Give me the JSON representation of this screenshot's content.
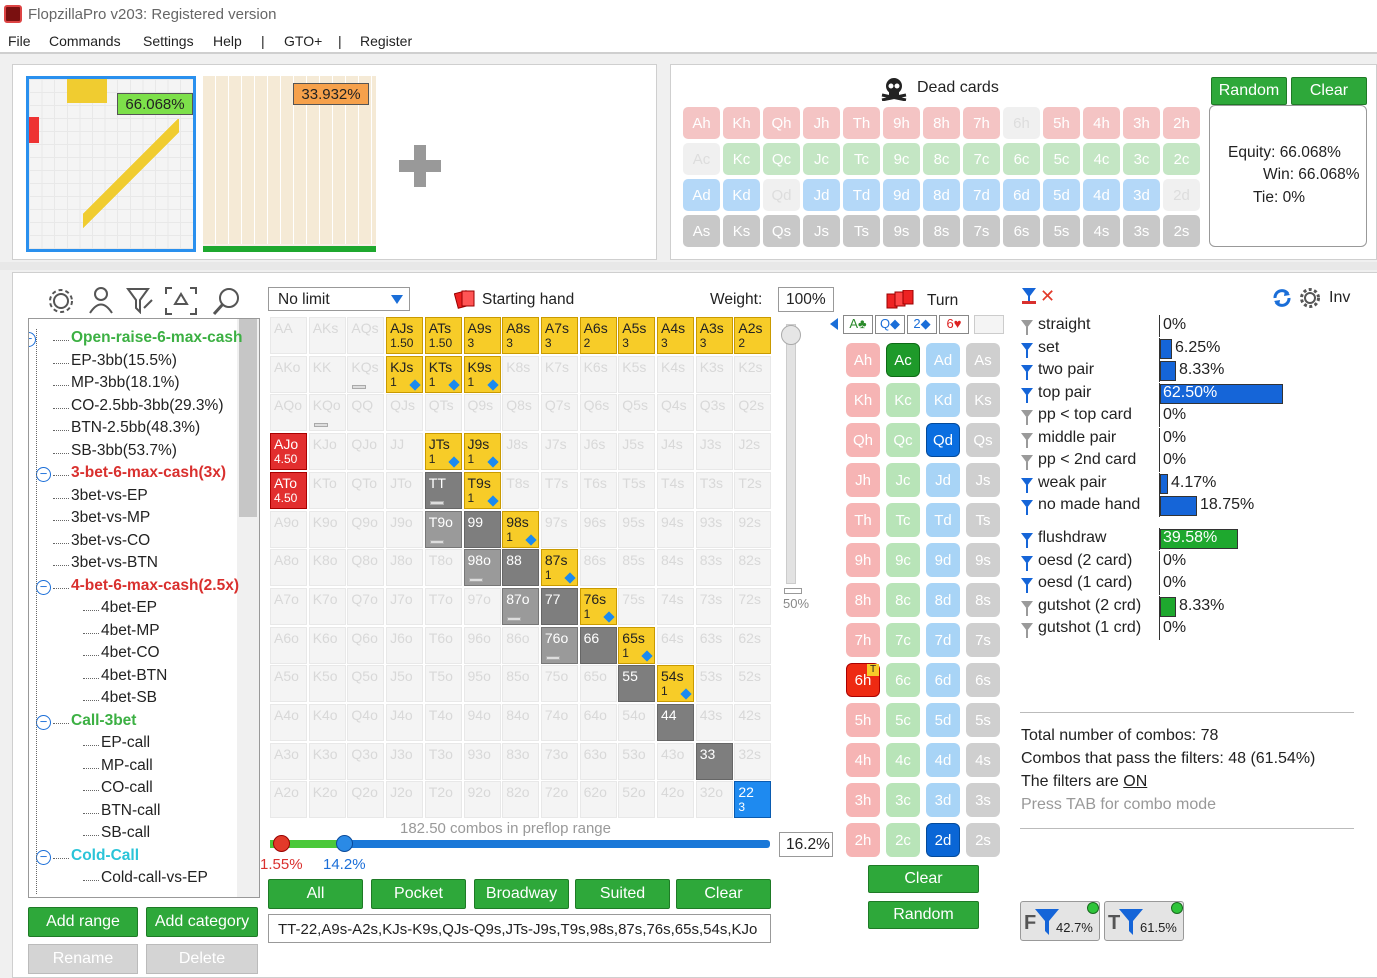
{
  "window": {
    "title": "FlopzillaPro v203: Registered version"
  },
  "menu": [
    "File",
    "Commands",
    "Settings",
    "Help",
    "|",
    "GTO+",
    "|",
    "Register"
  ],
  "thumbnails": [
    {
      "equity": "66.068%",
      "color": "#7de04a"
    },
    {
      "equity": "33.932%",
      "color": "#f6a14b"
    }
  ],
  "dead_cards": {
    "title": "Dead cards",
    "random_label": "Random",
    "clear_label": "Clear",
    "rows": [
      [
        "Ah",
        "Kh",
        "Qh",
        "Jh",
        "Th",
        "9h",
        "8h",
        "7h",
        "6h",
        "5h",
        "4h",
        "3h",
        "2h"
      ],
      [
        "Ac",
        "Kc",
        "Qc",
        "Jc",
        "Tc",
        "9c",
        "8c",
        "7c",
        "6c",
        "5c",
        "4c",
        "3c",
        "2c"
      ],
      [
        "Ad",
        "Kd",
        "Qd",
        "Jd",
        "Td",
        "9d",
        "8d",
        "7d",
        "6d",
        "5d",
        "4d",
        "3d",
        "2d"
      ],
      [
        "As",
        "Ks",
        "Qs",
        "Js",
        "Ts",
        "9s",
        "8s",
        "7s",
        "6s",
        "5s",
        "4s",
        "3s",
        "2s"
      ]
    ]
  },
  "equity": {
    "equity": "Equity: 66.068%",
    "win": "Win: 66.068%",
    "tie": "Tie: 0%"
  },
  "tree": [
    {
      "label": "Open-raise-6-max-cash",
      "level": 0,
      "color": "#3cb043",
      "bold": true
    },
    {
      "label": "EP-3bb(15.5%)",
      "level": 1
    },
    {
      "label": "MP-3bb(18.1%)",
      "level": 1
    },
    {
      "label": "CO-2.5bb-3bb(29.3%)",
      "level": 1
    },
    {
      "label": "BTN-2.5bb(48.3%)",
      "level": 1
    },
    {
      "label": "SB-3bb(53.7%)",
      "level": 1
    },
    {
      "label": "3-bet-6-max-cash(3x)",
      "level": 0,
      "color": "#d9302e",
      "bold": true
    },
    {
      "label": "3bet-vs-EP",
      "level": 1
    },
    {
      "label": "3bet-vs-MP",
      "level": 1
    },
    {
      "label": "3bet-vs-CO",
      "level": 1
    },
    {
      "label": "3bet-vs-BTN",
      "level": 1
    },
    {
      "label": "4-bet-6-max-cash(2.5x)",
      "level": 0,
      "color": "#d9302e",
      "bold": true
    },
    {
      "label": "4bet-EP",
      "level": 2
    },
    {
      "label": "4bet-MP",
      "level": 2
    },
    {
      "label": "4bet-CO",
      "level": 2
    },
    {
      "label": "4bet-BTN",
      "level": 2
    },
    {
      "label": "4bet-SB",
      "level": 2
    },
    {
      "label": "Call-3bet",
      "level": 0,
      "color": "#3cb043",
      "bold": true
    },
    {
      "label": "EP-call",
      "level": 2
    },
    {
      "label": "MP-call",
      "level": 2
    },
    {
      "label": "CO-call",
      "level": 2
    },
    {
      "label": "BTN-call",
      "level": 2
    },
    {
      "label": "SB-call",
      "level": 2
    },
    {
      "label": "Cold-Call",
      "level": 0,
      "color": "#2ac4d8",
      "bold": true
    },
    {
      "label": "Cold-call-vs-EP",
      "level": 2
    }
  ],
  "range_buttons": {
    "add_range": "Add range",
    "add_category": "Add category",
    "rename": "Rename",
    "delete": "Delete"
  },
  "matrix_header": {
    "limit": "No limit",
    "starting_hand": "Starting hand",
    "weight_label": "Weight:",
    "weight_value": "100%"
  },
  "matrix": [
    [
      "AA",
      "AKs",
      "AQs",
      "AJs",
      "ATs",
      "A9s",
      "A8s",
      "A7s",
      "A6s",
      "A5s",
      "A4s",
      "A3s",
      "A2s"
    ],
    [
      "AKo",
      "KK",
      "KQs",
      "KJs",
      "KTs",
      "K9s",
      "K8s",
      "K7s",
      "K6s",
      "K5s",
      "K4s",
      "K3s",
      "K2s"
    ],
    [
      "AQo",
      "KQo",
      "QQ",
      "QJs",
      "QTs",
      "Q9s",
      "Q8s",
      "Q7s",
      "Q6s",
      "Q5s",
      "Q4s",
      "Q3s",
      "Q2s"
    ],
    [
      "AJo",
      "KJo",
      "QJo",
      "JJ",
      "JTs",
      "J9s",
      "J8s",
      "J7s",
      "J6s",
      "J5s",
      "J4s",
      "J3s",
      "J2s"
    ],
    [
      "ATo",
      "KTo",
      "QTo",
      "JTo",
      "TT",
      "T9s",
      "T8s",
      "T7s",
      "T6s",
      "T5s",
      "T4s",
      "T3s",
      "T2s"
    ],
    [
      "A9o",
      "K9o",
      "Q9o",
      "J9o",
      "T9o",
      "99",
      "98s",
      "97s",
      "96s",
      "95s",
      "94s",
      "93s",
      "92s"
    ],
    [
      "A8o",
      "K8o",
      "Q8o",
      "J8o",
      "T8o",
      "98o",
      "88",
      "87s",
      "86s",
      "85s",
      "84s",
      "83s",
      "82s"
    ],
    [
      "A7o",
      "K7o",
      "Q7o",
      "J7o",
      "T7o",
      "97o",
      "87o",
      "77",
      "76s",
      "75s",
      "74s",
      "73s",
      "72s"
    ],
    [
      "A6o",
      "K6o",
      "Q6o",
      "J6o",
      "T6o",
      "96o",
      "86o",
      "76o",
      "66",
      "65s",
      "64s",
      "63s",
      "62s"
    ],
    [
      "A5o",
      "K5o",
      "Q5o",
      "J5o",
      "T5o",
      "95o",
      "85o",
      "75o",
      "65o",
      "55",
      "54s",
      "53s",
      "52s"
    ],
    [
      "A4o",
      "K4o",
      "Q4o",
      "J4o",
      "T4o",
      "94o",
      "84o",
      "74o",
      "64o",
      "54o",
      "44",
      "43s",
      "42s"
    ],
    [
      "A3o",
      "K3o",
      "Q3o",
      "J3o",
      "T3o",
      "93o",
      "83o",
      "73o",
      "63o",
      "53o",
      "43o",
      "33",
      "32s"
    ],
    [
      "A2o",
      "K2o",
      "Q2o",
      "J2o",
      "T2o",
      "92o",
      "82o",
      "72o",
      "62o",
      "52o",
      "42o",
      "32o",
      "22"
    ]
  ],
  "matrix_weights": {
    "AJs": "1.50",
    "ATs": "1.50",
    "A9s": "3",
    "A8s": "3",
    "A7s": "3",
    "A6s": "2",
    "A5s": "3",
    "A4s": "3",
    "A3s": "3",
    "A2s": "2",
    "KJs": "1",
    "KTs": "1",
    "K9s": "1",
    "JTs": "1",
    "J9s": "1",
    "T9s": "1",
    "98s": "1",
    "87s": "1",
    "76s": "1",
    "65s": "1",
    "54s": "1",
    "AJo": "4.50",
    "ATo": "4.50",
    "22": "3"
  },
  "slider": {
    "weight_pct": "50%",
    "combos_text": "182.50 combos in preflop range",
    "low": "1.55%",
    "high": "14.2%",
    "value": "16.2%"
  },
  "filter_buttons": [
    "All",
    "Pocket",
    "Broadway",
    "Suited",
    "Clear"
  ],
  "range_text": "TT-22,A9s-A2s,KJs-K9s,QJs-Q9s,JTs-J9s,T9s,98s,87s,76s,65s,54s,KJo",
  "turn": {
    "title": "Turn",
    "board": [
      "A♣",
      "Q◆",
      "2◆",
      "6♥"
    ],
    "clear_label": "Clear",
    "random_label": "Random",
    "rows": [
      [
        "Ah",
        "Ac",
        "Ad",
        "As"
      ],
      [
        "Kh",
        "Kc",
        "Kd",
        "Ks"
      ],
      [
        "Qh",
        "Qc",
        "Qd",
        "Qs"
      ],
      [
        "Jh",
        "Jc",
        "Jd",
        "Js"
      ],
      [
        "Th",
        "Tc",
        "Td",
        "Ts"
      ],
      [
        "9h",
        "9c",
        "9d",
        "9s"
      ],
      [
        "8h",
        "8c",
        "8d",
        "8s"
      ],
      [
        "7h",
        "7c",
        "7d",
        "7s"
      ],
      [
        "6h",
        "6c",
        "6d",
        "6s"
      ],
      [
        "5h",
        "5c",
        "5d",
        "5s"
      ],
      [
        "4h",
        "4c",
        "4d",
        "4s"
      ],
      [
        "3h",
        "3c",
        "3d",
        "3s"
      ],
      [
        "2h",
        "2c",
        "2d",
        "2s"
      ]
    ]
  },
  "stats": {
    "inv_label": "Inv",
    "made": [
      {
        "label": "straight",
        "value": "0%",
        "frac": 0,
        "active": false
      },
      {
        "label": "set",
        "value": "6.25%",
        "frac": 0.0625,
        "active": true
      },
      {
        "label": "two pair",
        "value": "8.33%",
        "frac": 0.0833,
        "active": true
      },
      {
        "label": "top pair",
        "value": "62.50%",
        "frac": 0.625,
        "active": true
      },
      {
        "label": "pp < top card",
        "value": "0%",
        "frac": 0,
        "active": false
      },
      {
        "label": "middle pair",
        "value": "0%",
        "frac": 0,
        "active": false
      },
      {
        "label": "pp < 2nd card",
        "value": "0%",
        "frac": 0,
        "active": false
      },
      {
        "label": "weak pair",
        "value": "4.17%",
        "frac": 0.0417,
        "active": true
      },
      {
        "label": "no made hand",
        "value": "18.75%",
        "frac": 0.1875,
        "active": true
      }
    ],
    "draws": [
      {
        "label": "flushdraw",
        "value": "39.58%",
        "frac": 0.3958,
        "active": true
      },
      {
        "label": "oesd (2 card)",
        "value": "0%",
        "frac": 0,
        "active": true
      },
      {
        "label": "oesd (1 card)",
        "value": "0%",
        "frac": 0,
        "active": true
      },
      {
        "label": "gutshot (2 crd)",
        "value": "8.33%",
        "frac": 0.0833,
        "active": false
      },
      {
        "label": "gutshot (1 crd)",
        "value": "0%",
        "frac": 0,
        "active": false
      }
    ],
    "total": "Total number of combos: 78",
    "pass": "Combos that pass the filters: 48 (61.54%)",
    "filters_on_prefix": "The filters are ",
    "filters_on": "ON",
    "tab_hint": "Press TAB for combo mode",
    "badge_f": "42.7%",
    "badge_t": "61.5%"
  }
}
